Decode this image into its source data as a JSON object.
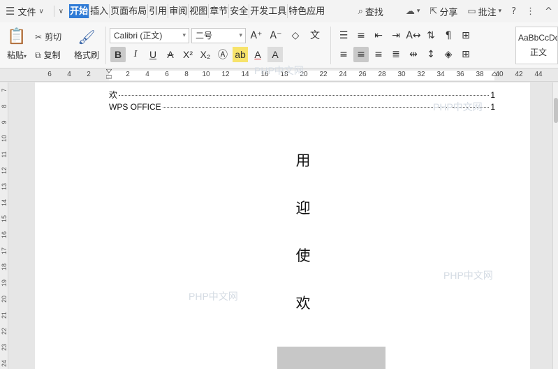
{
  "menubar": {
    "file_label": "文件",
    "tabs": [
      {
        "label": "开始",
        "active": true
      },
      {
        "label": "插入",
        "active": false
      },
      {
        "label": "页面布局",
        "active": false
      },
      {
        "label": "引用",
        "active": false
      },
      {
        "label": "审阅",
        "active": false
      },
      {
        "label": "视图",
        "active": false
      },
      {
        "label": "章节",
        "active": false
      },
      {
        "label": "安全",
        "active": false
      },
      {
        "label": "开发工具",
        "active": false
      },
      {
        "label": "特色应用",
        "active": false
      }
    ],
    "search_label": "查找",
    "share_label": "分享",
    "comment_label": "批注",
    "help_icon": "?",
    "more_icon": "⋮",
    "collapse_icon": "^"
  },
  "ribbon": {
    "paste_label": "粘贴",
    "cut_label": "剪切",
    "copy_label": "复制",
    "format_painter_label": "格式刷",
    "font_name": "Calibri (正文)",
    "font_size": "二号",
    "style_preview": "AaBbCcDd",
    "style_name": "正文",
    "accent_color": "#2f7bd6"
  },
  "ruler": {
    "numbers": [
      "6",
      "4",
      "2",
      "2",
      "4",
      "6",
      "8",
      "10",
      "12",
      "14",
      "16",
      "18",
      "20",
      "22",
      "24",
      "26",
      "28",
      "30",
      "32",
      "34",
      "36",
      "38",
      "40",
      "42",
      "44"
    ]
  },
  "vruler": {
    "numbers": [
      "7",
      "8",
      "9",
      "10",
      "11",
      "12",
      "13",
      "14",
      "15",
      "16",
      "17",
      "18",
      "19",
      "20",
      "21",
      "22",
      "23",
      "24"
    ]
  },
  "document": {
    "toc": [
      {
        "title": "欢",
        "page": "1"
      },
      {
        "title": "WPS OFFICE",
        "page": "1"
      }
    ],
    "vertical_chars": [
      "用",
      "迎",
      "使",
      "欢"
    ],
    "watermark_text": "PHP中文网"
  }
}
